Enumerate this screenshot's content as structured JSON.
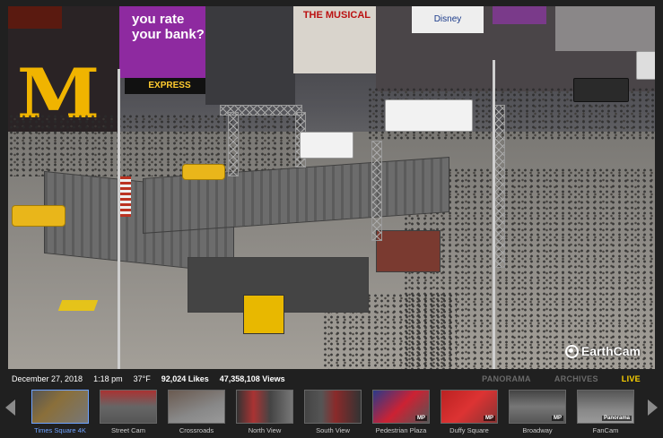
{
  "info": {
    "date": "December 27, 2018",
    "time": "1:18 pm",
    "temperature": "37°F",
    "likes": "92,024 Likes",
    "views": "47,358,108 Views"
  },
  "nav": {
    "panorama": "PANORAMA",
    "archives": "ARCHIVES",
    "live": "LIVE"
  },
  "branding": {
    "logo_text": "EarthCam"
  },
  "scene_signs": {
    "bank_ad": "you rate your bank?",
    "express": "EXPRESS",
    "musical": "THE MUSICAL",
    "disney": "Disney"
  },
  "thumbnails": [
    {
      "label": "Times Square 4K",
      "active": true,
      "badge": ""
    },
    {
      "label": "Street Cam",
      "active": false,
      "badge": ""
    },
    {
      "label": "Crossroads",
      "active": false,
      "badge": ""
    },
    {
      "label": "North View",
      "active": false,
      "badge": ""
    },
    {
      "label": "South View",
      "active": false,
      "badge": ""
    },
    {
      "label": "Pedestrian Plaza",
      "active": false,
      "badge": "MP"
    },
    {
      "label": "Duffy Square",
      "active": false,
      "badge": "MP"
    },
    {
      "label": "Broadway",
      "active": false,
      "badge": "MP"
    },
    {
      "label": "FanCam",
      "active": false,
      "badge": "Panorama"
    }
  ],
  "colors": {
    "active_thumb": "#6fa3ff",
    "live": "#ffd400",
    "inactive_nav": "#6a6a6a"
  },
  "icons": {
    "prev": "chevron-left-icon",
    "next": "chevron-right-icon"
  }
}
